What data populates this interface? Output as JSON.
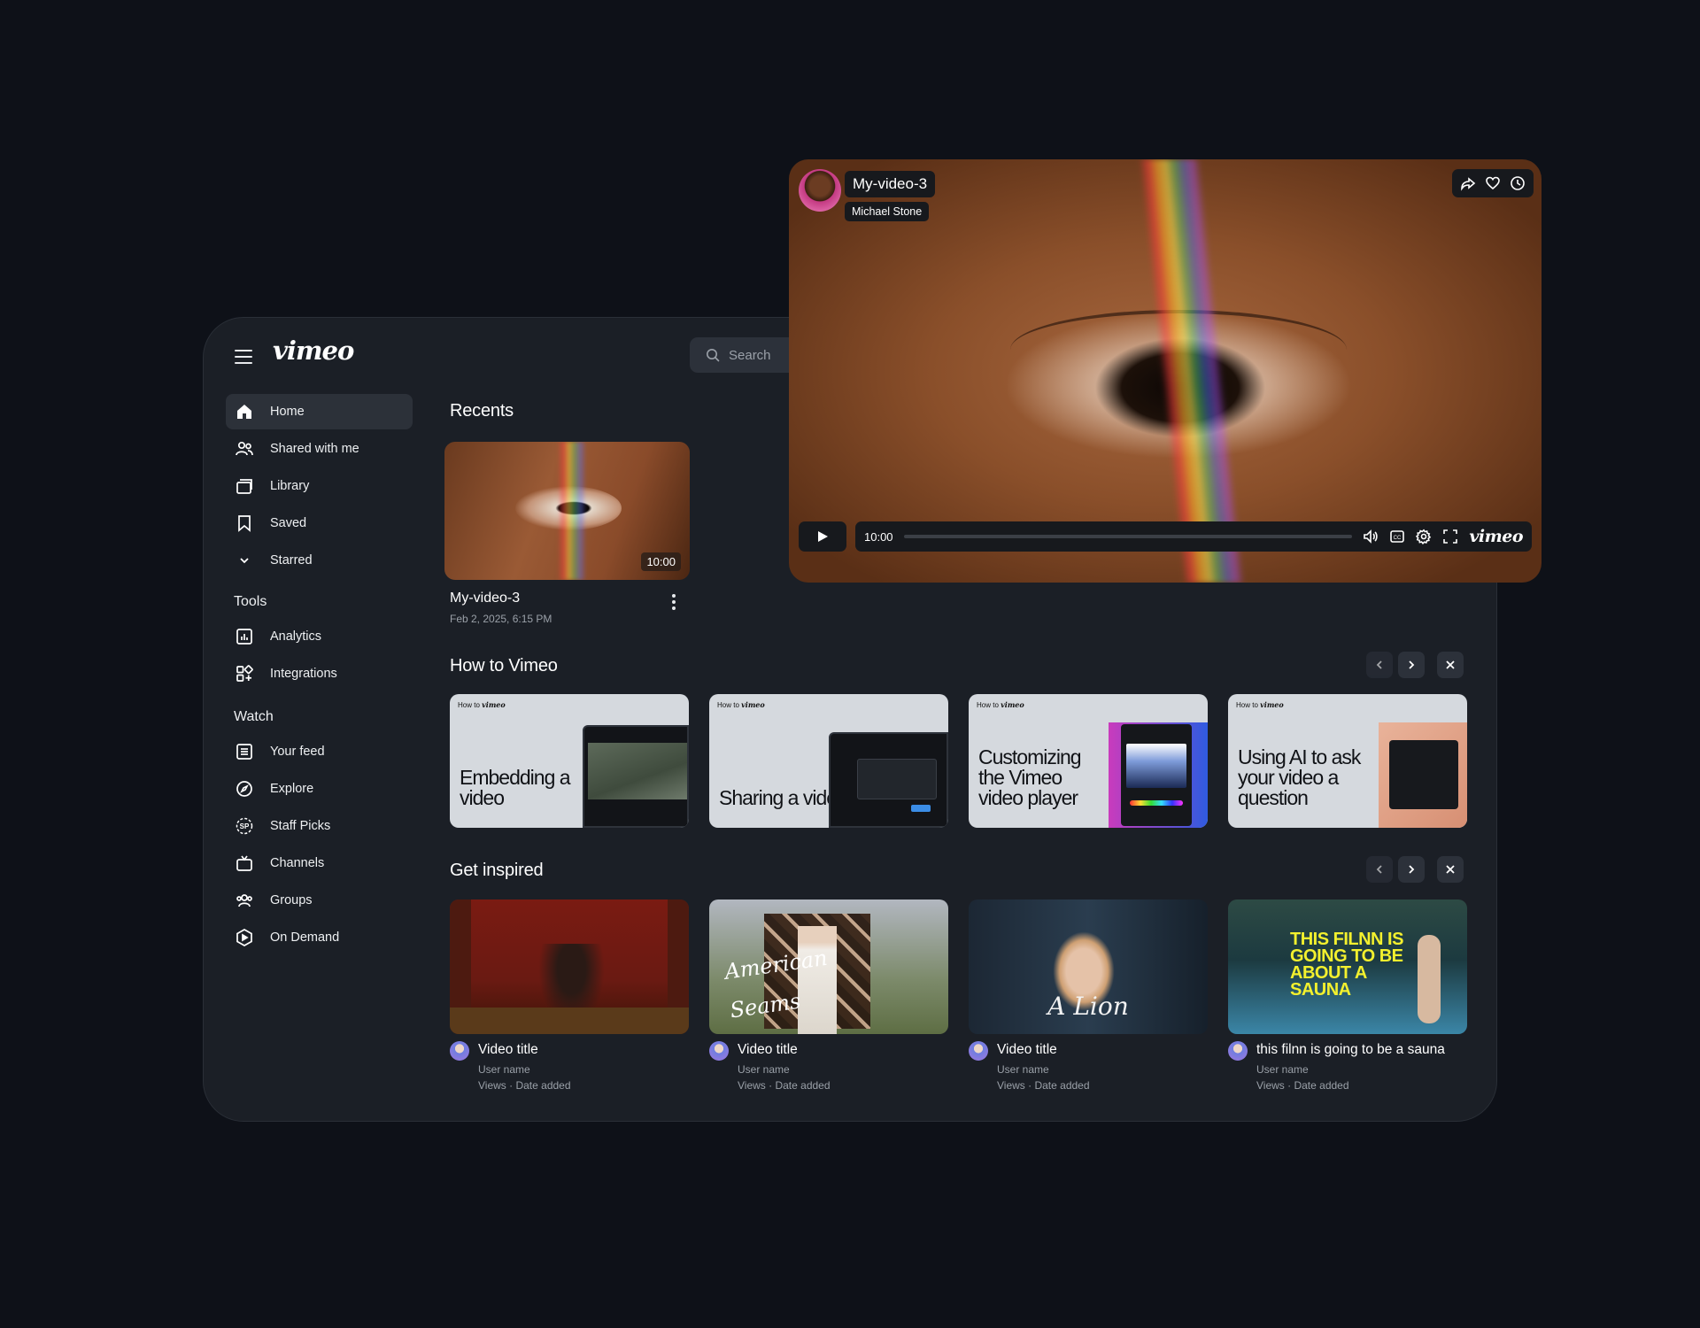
{
  "app": {
    "logo": "vimeo"
  },
  "search": {
    "placeholder": "Search"
  },
  "sidebar": {
    "items": [
      {
        "label": "Home"
      },
      {
        "label": "Shared with me"
      },
      {
        "label": "Library"
      },
      {
        "label": "Saved"
      },
      {
        "label": "Starred"
      }
    ],
    "tools_label": "Tools",
    "tools": [
      {
        "label": "Analytics"
      },
      {
        "label": "Integrations"
      }
    ],
    "watch_label": "Watch",
    "watch": [
      {
        "label": "Your feed"
      },
      {
        "label": "Explore"
      },
      {
        "label": "Staff Picks"
      },
      {
        "label": "Channels"
      },
      {
        "label": "Groups"
      },
      {
        "label": "On Demand"
      }
    ]
  },
  "recents": {
    "heading": "Recents",
    "video": {
      "title": "My-video-3",
      "date": "Feb 2, 2025, 6:15 PM",
      "duration": "10:00"
    }
  },
  "how_to": {
    "heading": "How to Vimeo",
    "tag_prefix": "How to",
    "tag_brand": "vimeo",
    "cards": [
      {
        "title": "Embedding a video"
      },
      {
        "title": "Sharing a video"
      },
      {
        "title": "Customizing the Vimeo video player"
      },
      {
        "title": "Using AI to ask your video a question"
      }
    ]
  },
  "get_inspired": {
    "heading": "Get inspired",
    "videos": [
      {
        "title": "Video title",
        "user": "User name",
        "meta": "Views · Date added"
      },
      {
        "title": "Video title",
        "user": "User name",
        "meta": "Views · Date added"
      },
      {
        "title": "Video title",
        "user": "User name",
        "meta": "Views · Date added"
      },
      {
        "title": "this filnn is going to be a sauna",
        "user": "User name",
        "meta": "Views · Date added"
      }
    ],
    "poster_text": {
      "second": "American Seams",
      "third": "A Lion",
      "fourth": "THIS FILNN IS GOING TO BE ABOUT A SAUNA"
    }
  },
  "player": {
    "title": "My-video-3",
    "author": "Michael Stone",
    "time": "10:00",
    "logo": "vimeo"
  }
}
